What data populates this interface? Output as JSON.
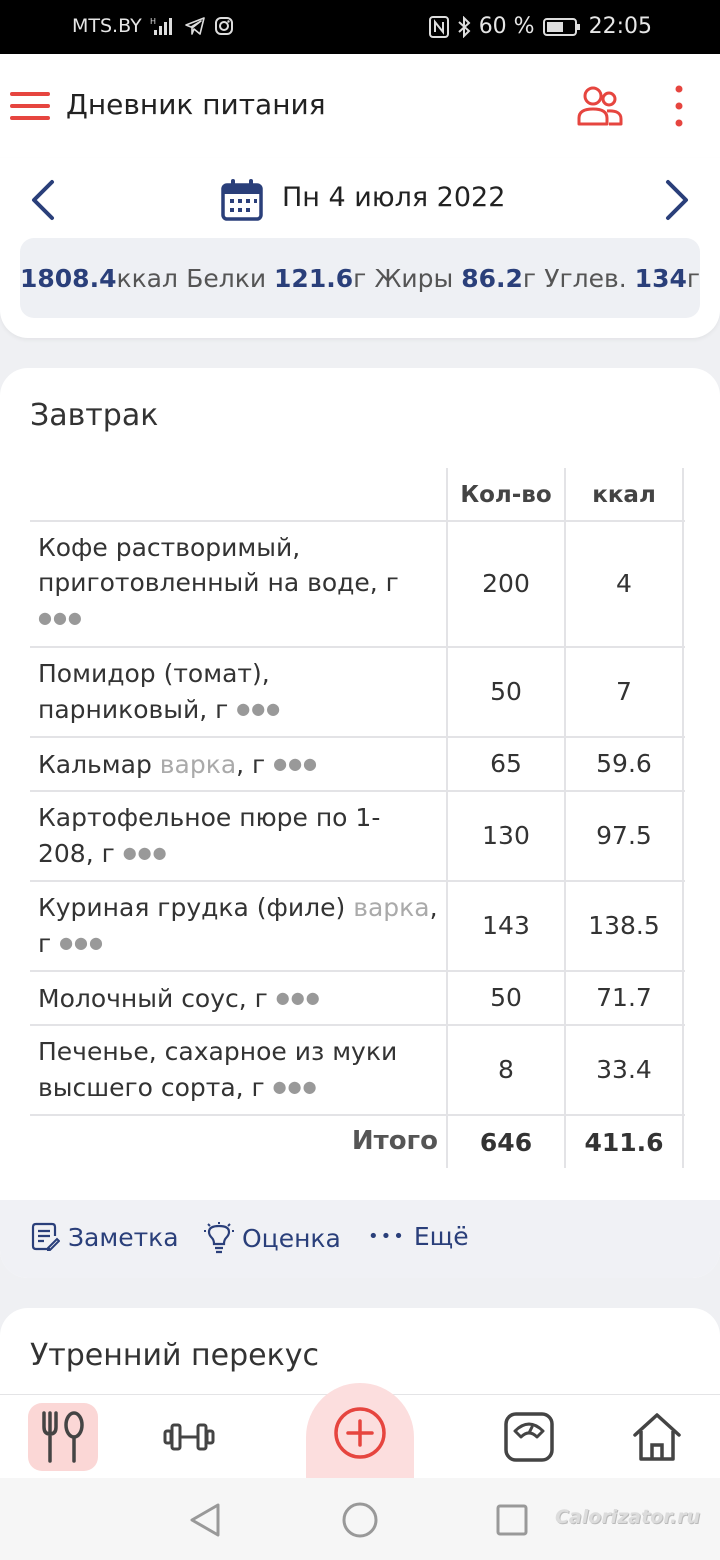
{
  "status_bar": {
    "carrier": "MTS.BY",
    "battery": "60 %",
    "time": "22:05"
  },
  "app_bar": {
    "title": "Дневник питания"
  },
  "date_bar": {
    "date": "Пн 4 июля 2022"
  },
  "summary": {
    "kcal_value": "1808.4",
    "kcal_unit": "ккал",
    "protein_label": "Белки",
    "protein_value": "121.6",
    "fat_label": "Жиры",
    "fat_value": "86.2",
    "carbs_label": "Углев.",
    "carbs_value": "134",
    "gram_unit": "г"
  },
  "breakfast": {
    "title": "Завтрак",
    "columns": {
      "qty": "Кол-во",
      "kcal": "ккал"
    },
    "rows": [
      {
        "name_line1": "Кофе растворимый,",
        "name_line2": "приготовленный на воде, г",
        "method": "",
        "qty": "200",
        "kcal": "4"
      },
      {
        "name_line1": "Помидор (томат),",
        "name_line2": "парниковый, г",
        "method": "",
        "qty": "50",
        "kcal": "7"
      },
      {
        "name_line1": "Кальмар",
        "name_line2": "",
        "method": "варка",
        "suffix": ", г",
        "qty": "65",
        "kcal": "59.6"
      },
      {
        "name_line1": "Картофельное пюре по 1-",
        "name_line2": "208, г",
        "method": "",
        "qty": "130",
        "kcal": "97.5"
      },
      {
        "name_line1": "Куриная грудка (филе)",
        "name_line2": "г",
        "method": "варка",
        "suffix": ",",
        "qty": "143",
        "kcal": "138.5"
      },
      {
        "name_line1": "Молочный соус, г",
        "name_line2": "",
        "method": "",
        "qty": "50",
        "kcal": "71.7"
      },
      {
        "name_line1": "Печенье, сахарное из муки",
        "name_line2": "высшего сорта, г",
        "method": "",
        "qty": "8",
        "kcal": "33.4"
      }
    ],
    "total": {
      "label": "Итого",
      "qty": "646",
      "kcal": "411.6"
    },
    "actions": {
      "note": "Заметка",
      "rating": "Оценка",
      "more": "Ещё"
    }
  },
  "next_meal": {
    "title": "Утренний перекус"
  },
  "watermark": "Calorizator.ru",
  "colors": {
    "accent_red": "#e6453f",
    "navy": "#2a3f7a",
    "active_tab_bg": "#fbd7d6"
  }
}
